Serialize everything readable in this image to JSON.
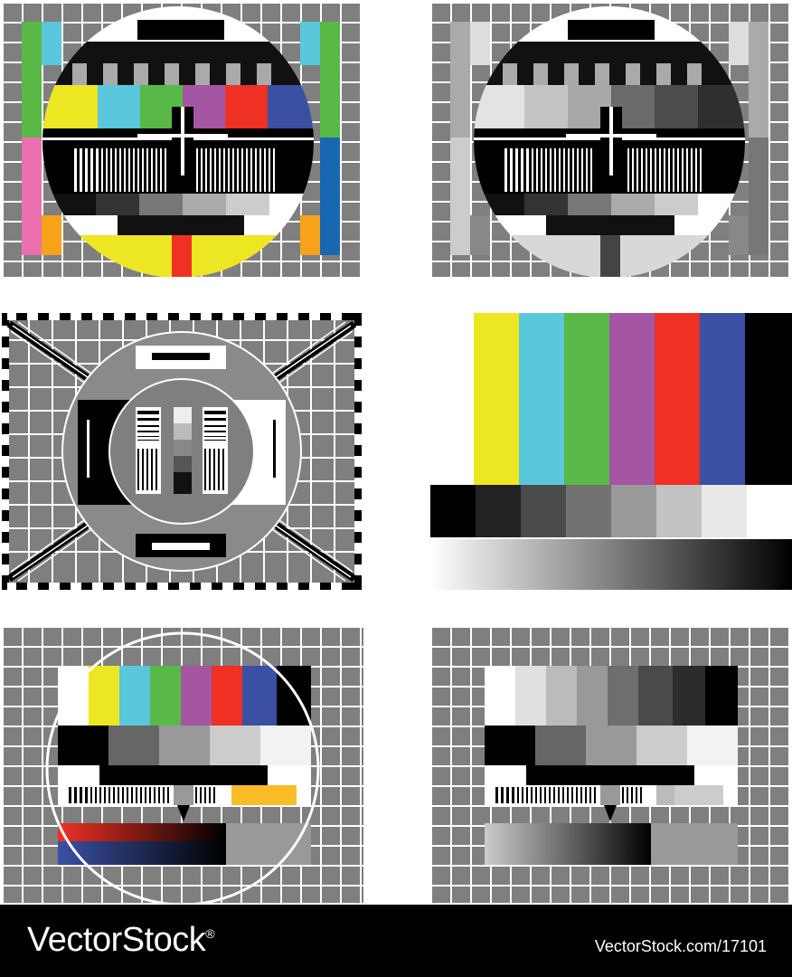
{
  "palette": {
    "yellow": "#ede623",
    "cyan": "#5ac7dc",
    "green": "#58b947",
    "magenta": "#a556a3",
    "red": "#ee3124",
    "blue": "#3b50a3",
    "black": "#000000",
    "orange": "#f7a21b",
    "pink": "#ec70b0",
    "deepblue": "#1a67b1"
  },
  "footer": {
    "brand": "VectorStock",
    "registered": "®",
    "url": "VectorStock.com/17101"
  }
}
